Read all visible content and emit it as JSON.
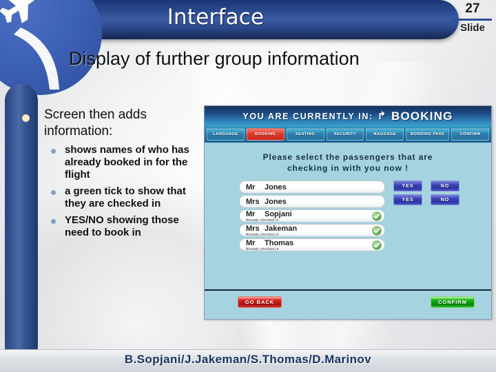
{
  "slide": {
    "title": "Interface",
    "subtitle": "Display of further group information",
    "number": "27",
    "number_label": "Slide",
    "footer": "B.Sopjani/J.Jakeman/S.Thomas/D.Marinov",
    "logo_icon": "airplane-icon"
  },
  "content": {
    "main_bullet": "Screen then adds information:",
    "sub_bullets": [
      "shows names of who has already booked in for the flight",
      "a green tick to show that they are checked in",
      "YES/NO showing those need to book in"
    ]
  },
  "app": {
    "status_prefix": "YOU  ARE  CURRENTLY  IN:",
    "status_arrow": "↱",
    "status_value": "BOOKING",
    "nav": [
      {
        "label": "LANGUAGE",
        "active": false
      },
      {
        "label": "BOOKING",
        "active": true
      },
      {
        "label": "SEATING",
        "active": false
      },
      {
        "label": "SECURITY",
        "active": false
      },
      {
        "label": "BAGGAGE",
        "active": false
      },
      {
        "label": "BORDING PASS",
        "active": false
      },
      {
        "label": "CONFIRM",
        "active": false
      }
    ],
    "instruction_line1": "Please  select  the  passengers  that  are",
    "instruction_line2": "checking  in  with  you  now !",
    "checked_note": "Already  checked  in",
    "passengers": [
      {
        "title": "Mr",
        "name": "Jones",
        "checked": false
      },
      {
        "title": "Mrs",
        "name": "Jones",
        "checked": false
      },
      {
        "title": "Mr",
        "name": "Sopjani",
        "checked": true
      },
      {
        "title": "Mrs",
        "name": "Jakeman",
        "checked": true
      },
      {
        "title": "Mr",
        "name": "Thomas",
        "checked": true
      }
    ],
    "choices": [
      {
        "yes": "YES",
        "no": "NO"
      },
      {
        "yes": "YES",
        "no": "NO"
      }
    ],
    "go_back_label": "GO BACK",
    "confirm_label": "CONFIRM",
    "colors": {
      "body": "#a6d3e0",
      "active_nav": "#e03a2c",
      "tick_green": "#5fb84e",
      "confirm_green": "#16b516",
      "goback_red": "#d9201a",
      "yes_no_blue": "#3b44b5"
    }
  }
}
